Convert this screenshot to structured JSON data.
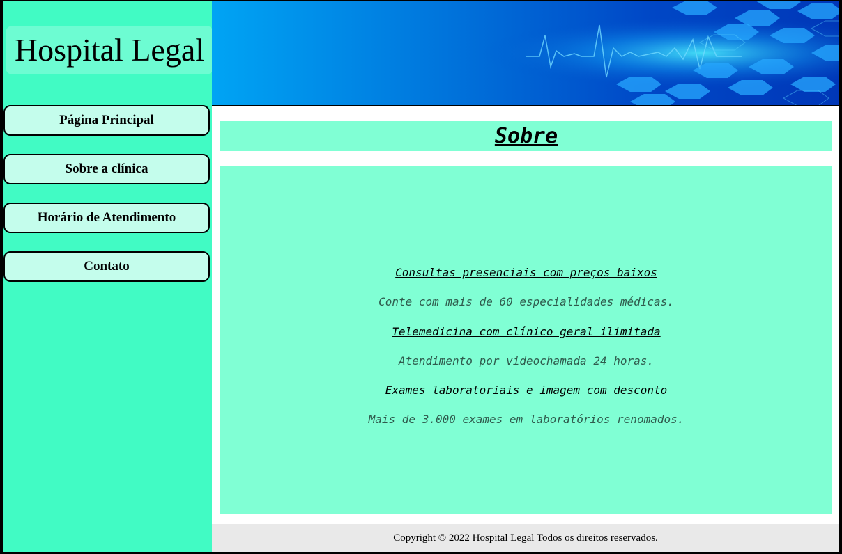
{
  "site": {
    "brand": "Hospital Legal"
  },
  "nav": {
    "items": [
      {
        "label": "Página Principal"
      },
      {
        "label": "Sobre a clínica"
      },
      {
        "label": "Horário de Atendimento"
      },
      {
        "label": "Contato"
      }
    ]
  },
  "main": {
    "title": "Sobre",
    "features": [
      {
        "title": "Consultas presenciais com preços baixos",
        "description": "Conte com mais de 60 especialidades médicas."
      },
      {
        "title": "Telemedicina com clínico geral ilimitada",
        "description": "Atendimento por videochamada 24 horas."
      },
      {
        "title": "Exames laboratoriais e imagem com desconto",
        "description": "Mais de 3.000 exames em laboratórios renomados."
      }
    ]
  },
  "footer": {
    "text": "Copyright © 2022 Hospital Legal Todos os direitos reservados."
  },
  "colors": {
    "sidebar": "#41fbc4",
    "nav_button": "#c4fdec",
    "content_panel": "#80ffd4",
    "banner_blue": "#0077dd"
  },
  "banner": {
    "icon": "medical-hexagon-heartbeat-banner"
  }
}
